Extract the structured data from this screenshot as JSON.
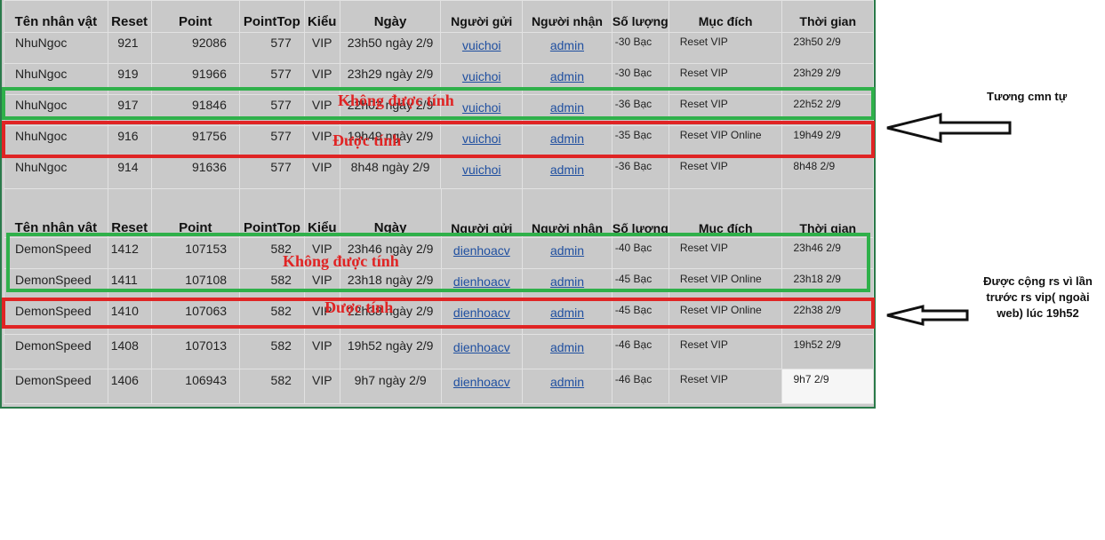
{
  "headers": {
    "name": "Tên nhân vật",
    "reset": "Reset",
    "point": "Point",
    "pointtop": "PointTop",
    "kieu": "Kiểu",
    "ngay": "Ngày",
    "sender": "Người gửi",
    "receiver": "Người nhận",
    "qty": "Số lượng",
    "purpose": "Mục đích",
    "time": "Thời gian"
  },
  "table1": [
    {
      "name": "NhuNgoc",
      "reset": "921",
      "point": "92086",
      "pointtop": "577",
      "kieu": "VIP",
      "ngay": "23h50 ngày 2/9",
      "sender": "vuichoi",
      "receiver": "admin",
      "qty": "-30  Bạc",
      "purpose": "Reset VIP",
      "time": "23h50 2/9"
    },
    {
      "name": "NhuNgoc",
      "reset": "919",
      "point": "91966",
      "pointtop": "577",
      "kieu": "VIP",
      "ngay": "23h29 ngày 2/9",
      "sender": "vuichoi",
      "receiver": "admin",
      "qty": "-30  Bạc",
      "purpose": "Reset VIP",
      "time": "23h29 2/9"
    },
    {
      "name": "NhuNgoc",
      "reset": "917",
      "point": "91846",
      "pointtop": "577",
      "kieu": "VIP",
      "ngay": "22h02 ngày 2/9",
      "sender": "vuichoi",
      "receiver": "admin",
      "qty": "-36  Bạc",
      "purpose": "Reset VIP",
      "time": "22h52 2/9"
    },
    {
      "name": "NhuNgoc",
      "reset": "916",
      "point": "91756",
      "pointtop": "577",
      "kieu": "VIP",
      "ngay": "19h49 ngày 2/9",
      "sender": "vuichoi",
      "receiver": "admin",
      "qty": "-35  Bạc",
      "purpose": "Reset VIP Online",
      "time": "19h49 2/9"
    },
    {
      "name": "NhuNgoc",
      "reset": "914",
      "point": "91636",
      "pointtop": "577",
      "kieu": "VIP",
      "ngay": "8h48 ngày 2/9",
      "sender": "vuichoi",
      "receiver": "admin",
      "qty": "-36  Bạc",
      "purpose": "Reset VIP",
      "time": "8h48 2/9"
    }
  ],
  "table2": [
    {
      "name": "DemonSpeed",
      "reset": "1412",
      "point": "107153",
      "pointtop": "582",
      "kieu": "VIP",
      "ngay": "23h46 ngày 2/9",
      "sender": "dienhoacv",
      "receiver": "admin",
      "qty": "-40  Bạc",
      "purpose": "Reset VIP",
      "time": "23h46 2/9"
    },
    {
      "name": "DemonSpeed",
      "reset": "1411",
      "point": "107108",
      "pointtop": "582",
      "kieu": "VIP",
      "ngay": "23h18 ngày 2/9",
      "sender": "dienhoacv",
      "receiver": "admin",
      "qty": "-45  Bạc",
      "purpose": "Reset VIP Online",
      "time": "23h18 2/9"
    },
    {
      "name": "DemonSpeed",
      "reset": "1410",
      "point": "107063",
      "pointtop": "582",
      "kieu": "VIP",
      "ngay": "22h38 ngày 2/9",
      "sender": "dienhoacv",
      "receiver": "admin",
      "qty": "-45  Bạc",
      "purpose": "Reset VIP Online",
      "time": "22h38 2/9"
    },
    {
      "name": "DemonSpeed",
      "reset": "1408",
      "point": "107013",
      "pointtop": "582",
      "kieu": "VIP",
      "ngay": "19h52 ngày 2/9",
      "sender": "dienhoacv",
      "receiver": "admin",
      "qty": "-46  Bạc",
      "purpose": "Reset VIP",
      "time": "19h52 2/9"
    },
    {
      "name": "DemonSpeed",
      "reset": "1406",
      "point": "106943",
      "pointtop": "582",
      "kieu": "VIP",
      "ngay": "9h7 ngày 2/9",
      "sender": "dienhoacv",
      "receiver": "admin",
      "qty": "-46  Bạc",
      "purpose": "Reset VIP",
      "time": "9h7 2/9"
    }
  ],
  "annotations": {
    "not_counted": "Không được tính",
    "counted": "Được tính",
    "note_top": "Tương cmn tự",
    "note_bottom": "Được cộng rs vì lần trước rs vip( ngoài web) lúc 19h52"
  },
  "colors": {
    "green_box": "#2fb04a",
    "red_box": "#e02424",
    "link": "#1f4fa0",
    "cell_bg": "#c9c9c9"
  }
}
